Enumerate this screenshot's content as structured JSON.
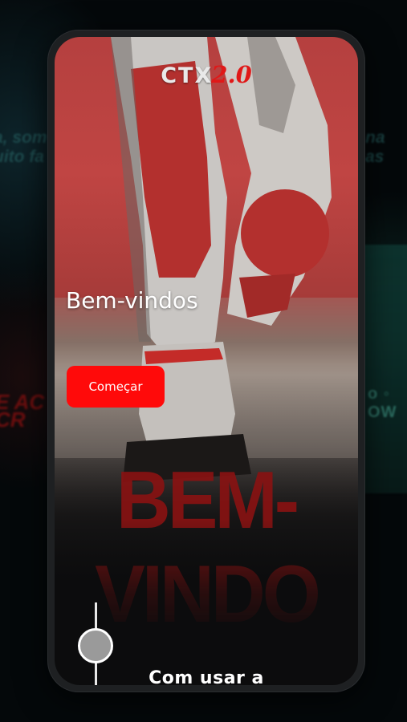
{
  "background": {
    "left_text": "a, som\nuito fa",
    "right_text": "na\nas",
    "left_red_text": "E AC\nCR",
    "right_small_text": "o ◦\nOW"
  },
  "app": {
    "logo_text": "CTX",
    "logo_version": "2.0",
    "welcome_title": "Bem-vindos",
    "start_button_label": "Começar",
    "big_word": "BEM-VINDO",
    "section_title": "Com usar a"
  },
  "colors": {
    "accent": "#ff0a0a",
    "background": "#0c0c0d",
    "text": "#ffffff"
  },
  "slider": {
    "icon": "slider-knob"
  }
}
